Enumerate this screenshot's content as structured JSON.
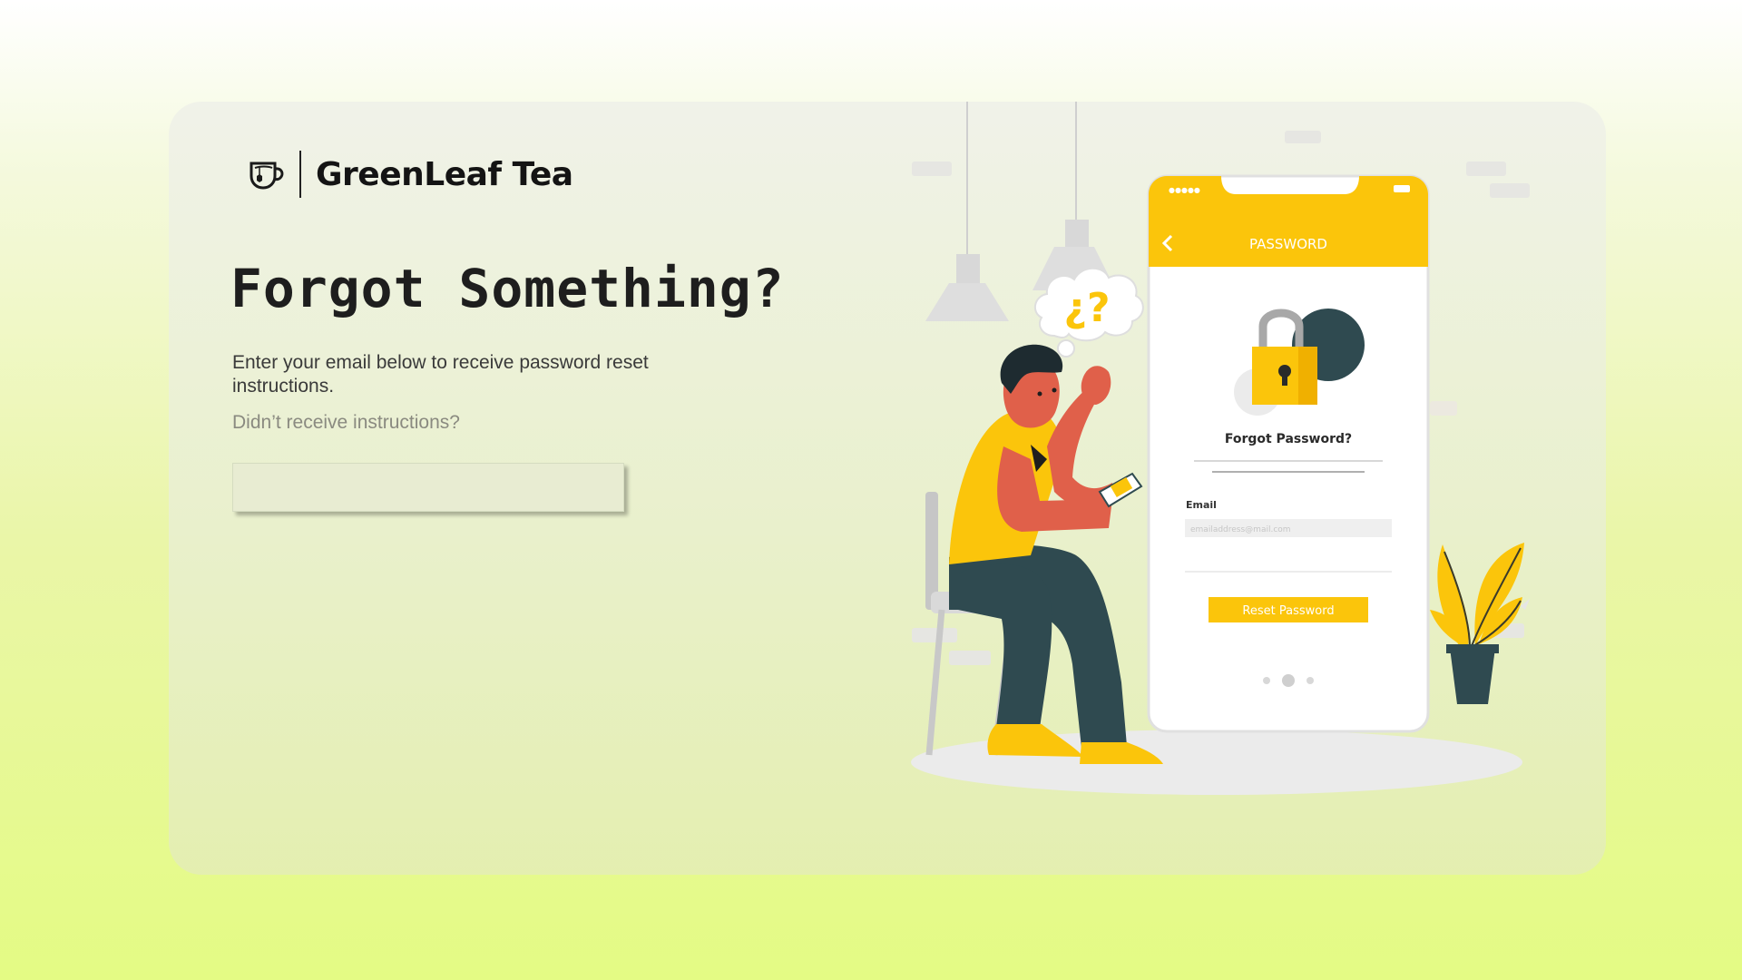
{
  "brand": {
    "name": "GreenLeaf Tea",
    "logo_icon": "teacup-icon"
  },
  "page": {
    "title": "Forgot Something?",
    "instructions": "Enter your email below to receive password reset instructions.",
    "resend_link": "Didn’t receive instructions?"
  },
  "form": {
    "email_value": "",
    "email_placeholder": ""
  },
  "illustration": {
    "phone_header": "PASSWORD",
    "phone_heading": "Forgot Password?",
    "phone_email_label": "Email",
    "phone_email_placeholder": "emailaddress@mail.com",
    "phone_button": "Reset Password",
    "thought_text": "¿?"
  },
  "colors": {
    "accent_yellow": "#fbc50b",
    "dark_teal": "#2f4a50",
    "skin": "#e0604a",
    "background_lime": "#e4fb84"
  }
}
